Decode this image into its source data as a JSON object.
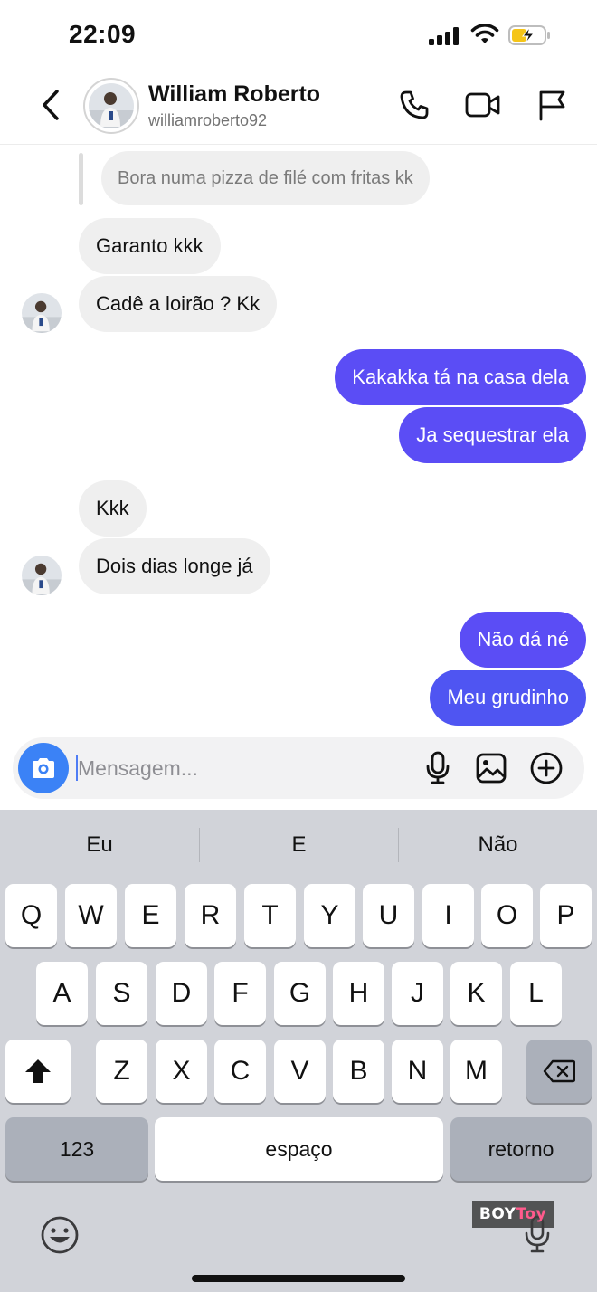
{
  "status_bar": {
    "time": "22:09"
  },
  "header": {
    "name": "William Roberto",
    "username": "williamroberto92"
  },
  "chat": {
    "reply_quote": "Bora numa pizza de filé com fritas kk",
    "messages": [
      {
        "side": "in",
        "text": "Garanto kkk"
      },
      {
        "side": "in",
        "text": "Cadê a loirão ? Kk"
      },
      {
        "side": "out",
        "text": "Kakakka tá na casa dela"
      },
      {
        "side": "out",
        "text": "Ja sequestrar ela"
      },
      {
        "side": "in",
        "text": "Kkk"
      },
      {
        "side": "in",
        "text": "Dois dias longe já"
      },
      {
        "side": "out",
        "text": "Não dá né"
      },
      {
        "side": "out",
        "text": "Meu grudinho"
      }
    ]
  },
  "composer": {
    "placeholder": "Mensagem...",
    "value": ""
  },
  "keyboard": {
    "suggestions": [
      "Eu",
      "E",
      "Não"
    ],
    "row1": [
      "Q",
      "W",
      "E",
      "R",
      "T",
      "Y",
      "U",
      "I",
      "O",
      "P"
    ],
    "row2": [
      "A",
      "S",
      "D",
      "F",
      "G",
      "H",
      "J",
      "K",
      "L"
    ],
    "row3": [
      "Z",
      "X",
      "C",
      "V",
      "B",
      "N",
      "M"
    ],
    "numbers_label": "123",
    "space_label": "espaço",
    "return_label": "retorno"
  },
  "watermark": {
    "part1": "BOY",
    "part2": "Toy"
  },
  "colors": {
    "outgoing_bubble": "#5b4df5",
    "incoming_bubble": "#efefef",
    "camera_button": "#3b82f6",
    "keyboard_bg": "#d1d3d9"
  },
  "icons": [
    "back-chevron-icon",
    "phone-icon",
    "video-camera-icon",
    "flag-icon",
    "camera-icon",
    "microphone-icon",
    "gallery-icon",
    "add-circle-icon",
    "shift-icon",
    "backspace-icon",
    "emoji-icon",
    "dictation-mic-icon"
  ]
}
